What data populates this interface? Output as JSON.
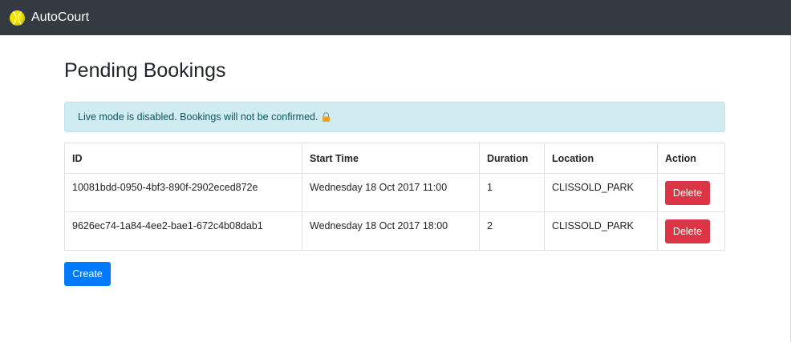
{
  "navbar": {
    "brand": "AutoCourt",
    "logo_icon": "tennis-ball-icon",
    "background": "#343a40"
  },
  "page": {
    "title": "Pending Bookings"
  },
  "alert": {
    "text": "Live mode is disabled. Bookings will not be confirmed.",
    "icon": "lock-icon",
    "background": "#d1ecf1",
    "color": "#0c5460"
  },
  "table": {
    "headers": [
      "ID",
      "Start Time",
      "Duration",
      "Location",
      "Action"
    ],
    "rows": [
      {
        "id": "10081bdd-0950-4bf3-890f-2902eced872e",
        "start_time": "Wednesday 18 Oct 2017 11:00",
        "duration": "1",
        "location": "CLISSOLD_PARK",
        "action_label": "Delete"
      },
      {
        "id": "9626ec74-1a84-4ee2-bae1-672c4b08dab1",
        "start_time": "Wednesday 18 Oct 2017 18:00",
        "duration": "2",
        "location": "CLISSOLD_PARK",
        "action_label": "Delete"
      }
    ]
  },
  "actions": {
    "create_label": "Create"
  },
  "colors": {
    "danger": "#dc3545",
    "primary": "#007bff"
  }
}
